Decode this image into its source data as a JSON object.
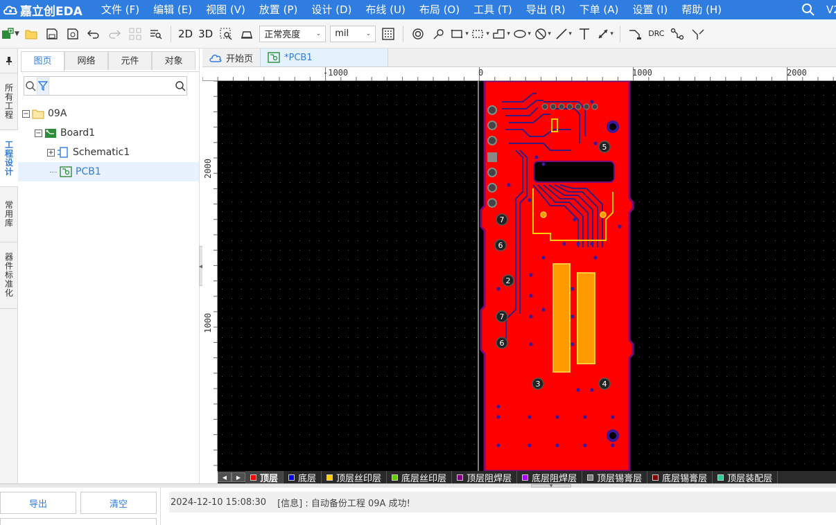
{
  "app": {
    "logo_text": "嘉立创EDA",
    "version": "V2"
  },
  "menu": {
    "items": [
      "文件 (F)",
      "编辑 (E)",
      "视图 (V)",
      "放置 (P)",
      "设计 (D)",
      "布线 (U)",
      "布局 (O)",
      "工具 (T)",
      "导出 (R)",
      "下单 (A)",
      "设置 (I)",
      "帮助 (H)"
    ]
  },
  "toolbar": {
    "view_2d": "2D",
    "view_3d": "3D",
    "brightness_select": "正常亮度",
    "unit_select": "mil",
    "drc_label": "DRC"
  },
  "vertical_tabs": [
    "所有工程",
    "工程设计",
    "常用库",
    "器件标准化"
  ],
  "left_panel": {
    "tabs": [
      "图页",
      "网络",
      "元件",
      "对象"
    ],
    "search_placeholder": "",
    "tree": {
      "project": "09A",
      "board": "Board1",
      "schematic": "Schematic1",
      "pcb": "PCB1"
    }
  },
  "doc_tabs": {
    "home": "开始页",
    "pcb": "*PCB1"
  },
  "ruler": {
    "h_labels": [
      "-1000",
      "0",
      "1000",
      "2000"
    ],
    "v_labels": [
      "2000",
      "1000"
    ]
  },
  "pcb": {
    "hole_labels": [
      "5",
      "7",
      "6",
      "2",
      "7",
      "6",
      "3",
      "4"
    ]
  },
  "layers": [
    {
      "name": "顶层",
      "color": "#ff0000"
    },
    {
      "name": "底层",
      "color": "#0000ff"
    },
    {
      "name": "顶层丝印层",
      "color": "#ffcc00"
    },
    {
      "name": "底层丝印层",
      "color": "#66cc00"
    },
    {
      "name": "顶层阻焊层",
      "color": "#800080"
    },
    {
      "name": "底层阻焊层",
      "color": "#aa00ff"
    },
    {
      "name": "顶层锡膏层",
      "color": "#808080"
    },
    {
      "name": "底层锡膏层",
      "color": "#800000"
    },
    {
      "name": "顶层装配层",
      "color": "#33cc99"
    }
  ],
  "bottom": {
    "export_label": "导出",
    "clear_label": "清空",
    "log_time": "2024-12-10 15:08:30",
    "log_message": "[信息] : 自动备份工程 09A 成功!"
  }
}
